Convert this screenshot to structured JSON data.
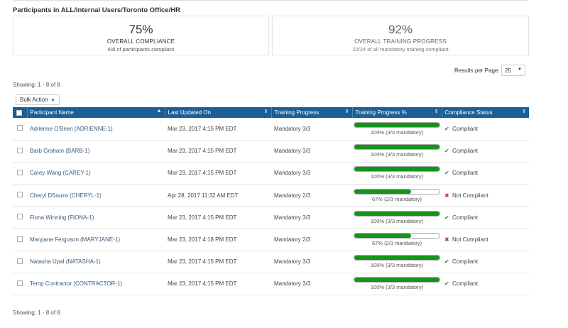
{
  "page": {
    "title": "Participants in ALL/Internal Users/Toronto Office/HR"
  },
  "summary": {
    "compliance": {
      "pct": "75%",
      "label": "OVERALL COMPLIANCE",
      "sub": "6/8 of participants compliant"
    },
    "training": {
      "pct": "92%",
      "label": "OVERALL TRAINING PROGRESS",
      "sub": "22/24 of all mandatory training compliant"
    }
  },
  "pagination": {
    "results_label": "Results per Page:",
    "results_value": "25",
    "showing_top": "Showing: 1 - 8 of 8",
    "showing_bottom": "Showing: 1 - 8 of 8"
  },
  "bulk_action": {
    "label": "Bulk Action"
  },
  "table": {
    "columns": [
      "Participant Name",
      "Last Updated On",
      "Training Progress",
      "Training Progress %",
      "Compliance Status"
    ],
    "rows": [
      {
        "name": "Adrienne O'Brien (ADRIENNE-1)",
        "updated": "Mar 23, 2017 4:15 PM EDT",
        "progress": "Mandatory 3/3",
        "pct": 100,
        "pct_text": "100% (3/3 mandatory)",
        "status": "Compliant"
      },
      {
        "name": "Barb Graham (BARB-1)",
        "updated": "Mar 23, 2017 4:15 PM EDT",
        "progress": "Mandatory 3/3",
        "pct": 100,
        "pct_text": "100% (3/3 mandatory)",
        "status": "Compliant"
      },
      {
        "name": "Carey Wang (CAREY-1)",
        "updated": "Mar 23, 2017 4:15 PM EDT",
        "progress": "Mandatory 3/3",
        "pct": 100,
        "pct_text": "100% (3/3 mandatory)",
        "status": "Compliant"
      },
      {
        "name": "Cheryl DSouza (CHERYL-1)",
        "updated": "Apr 28, 2017 11:32 AM EDT",
        "progress": "Mandatory 2/3",
        "pct": 67,
        "pct_text": "67% (2/3 mandatory)",
        "status": "Not Compliant"
      },
      {
        "name": "Fiona Winning (FIONA-1)",
        "updated": "Mar 23, 2017 4:15 PM EDT",
        "progress": "Mandatory 3/3",
        "pct": 100,
        "pct_text": "100% (3/3 mandatory)",
        "status": "Compliant"
      },
      {
        "name": "Maryjane Ferguson (MARYJANE-1)",
        "updated": "Mar 23, 2017 4:18 PM EDT",
        "progress": "Mandatory 2/3",
        "pct": 67,
        "pct_text": "67% (2/3 mandatory)",
        "status": "Not Compliant"
      },
      {
        "name": "Natasha Upal (NATASHA-1)",
        "updated": "Mar 23, 2017 4:15 PM EDT",
        "progress": "Mandatory 3/3",
        "pct": 100,
        "pct_text": "100% (3/3 mandatory)",
        "status": "Compliant"
      },
      {
        "name": "Temp Contractor (CONTRACTOR-1)",
        "updated": "Mar 23, 2017 4:15 PM EDT",
        "progress": "Mandatory 3/3",
        "pct": 100,
        "pct_text": "100% (3/3 mandatory)",
        "status": "Compliant"
      }
    ]
  },
  "icons": {
    "compliant": "check-icon",
    "not_compliant": "x-icon",
    "sort_asc": "sort-up-icon",
    "sort_both": "sort-icon",
    "dropdown": "caret-down-icon"
  },
  "colors": {
    "header_bg": "#1b5f96",
    "progress_fill": "#14941c",
    "compliant": "#2a8c2a",
    "not_compliant": "#c0392b"
  }
}
